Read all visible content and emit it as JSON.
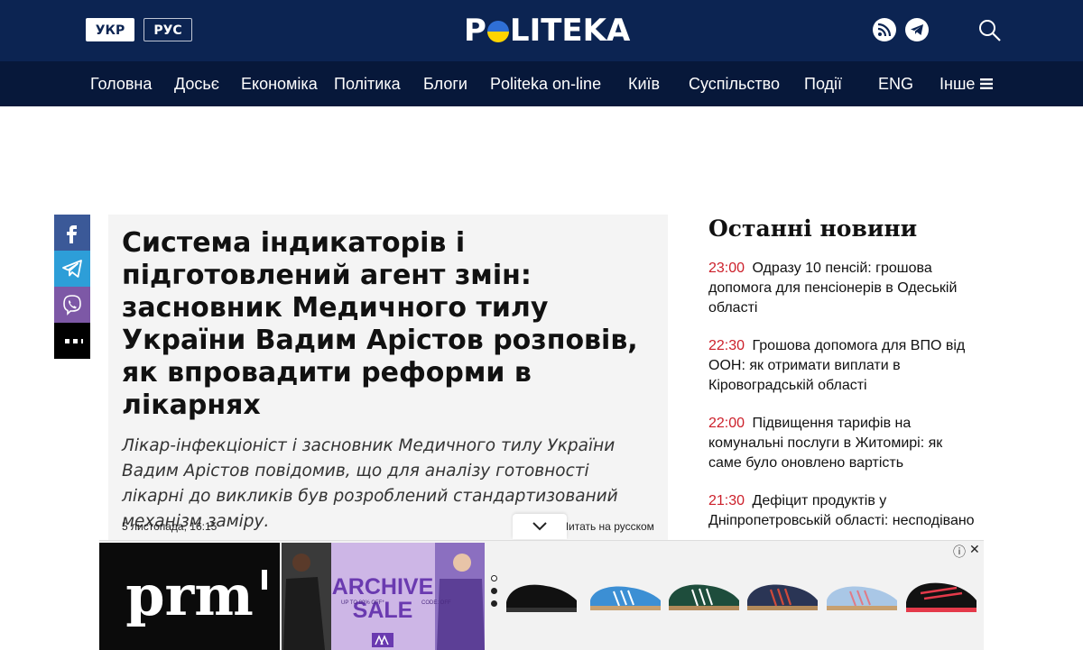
{
  "header": {
    "lang_ukr": "УКР",
    "lang_rus": "РУС",
    "logo": {
      "pre": "P",
      "post": "LITEKA"
    }
  },
  "nav": {
    "items": [
      "Головна",
      "Досьє",
      "Економіка",
      "Політика",
      "Блоги",
      "Politeka on-line",
      "Київ",
      "Суспільство",
      "Події",
      "ENG",
      "Інше"
    ]
  },
  "share": {
    "buttons": [
      "facebook-icon",
      "telegram-icon",
      "viber-icon",
      "more-icon"
    ],
    "colors": {
      "facebook": "#3b5998",
      "telegram": "#2d9ed8",
      "viber": "#7d58a6",
      "more": "#000000"
    }
  },
  "article": {
    "title": "Система індикаторів і підготовлений агент змін: засновник Медичного тилу України Вадим Арістов розповів, як впровадити реформи в лікарнях",
    "lead": "Лікар-інфекціоніст і засновник Медичного тилу України Вадим Арістов повідомив, що для аналізу готовності лікарні до викликів був розроблений стандартизований механізм заміру.",
    "date": "5 листопада, 16:15",
    "read_ru": "Читать на русском"
  },
  "sidebar": {
    "title": "Останні новини",
    "news": [
      {
        "time": "23:00",
        "text": "Одразу 10 пенсій: грошова допомога для пенсіонерів в Одеській області"
      },
      {
        "time": "22:30",
        "text": "Грошова допомога для ВПО від ООН: як отримати виплати в Кіровоградській області"
      },
      {
        "time": "22:00",
        "text": "Підвищення тарифів на комунальні послуги в Житомирі: як саме було оновлено вартість"
      },
      {
        "time": "21:30",
        "text": "Дефіцит продуктів у Дніпропетровській області: несподівано"
      }
    ]
  },
  "ad": {
    "logo_text": "prm",
    "banner_line1": "ARCHIVE",
    "banner_line2": "SALE",
    "small_left": "UP TO 80% OFF*",
    "small_right": "CODE: OFF",
    "info": "ⓘ",
    "close": "✕"
  },
  "colors": {
    "topbar": "#0c2452",
    "navbar": "#07183a",
    "news_time": "#cc1f2a",
    "article_bg": "#f4f4f4"
  }
}
